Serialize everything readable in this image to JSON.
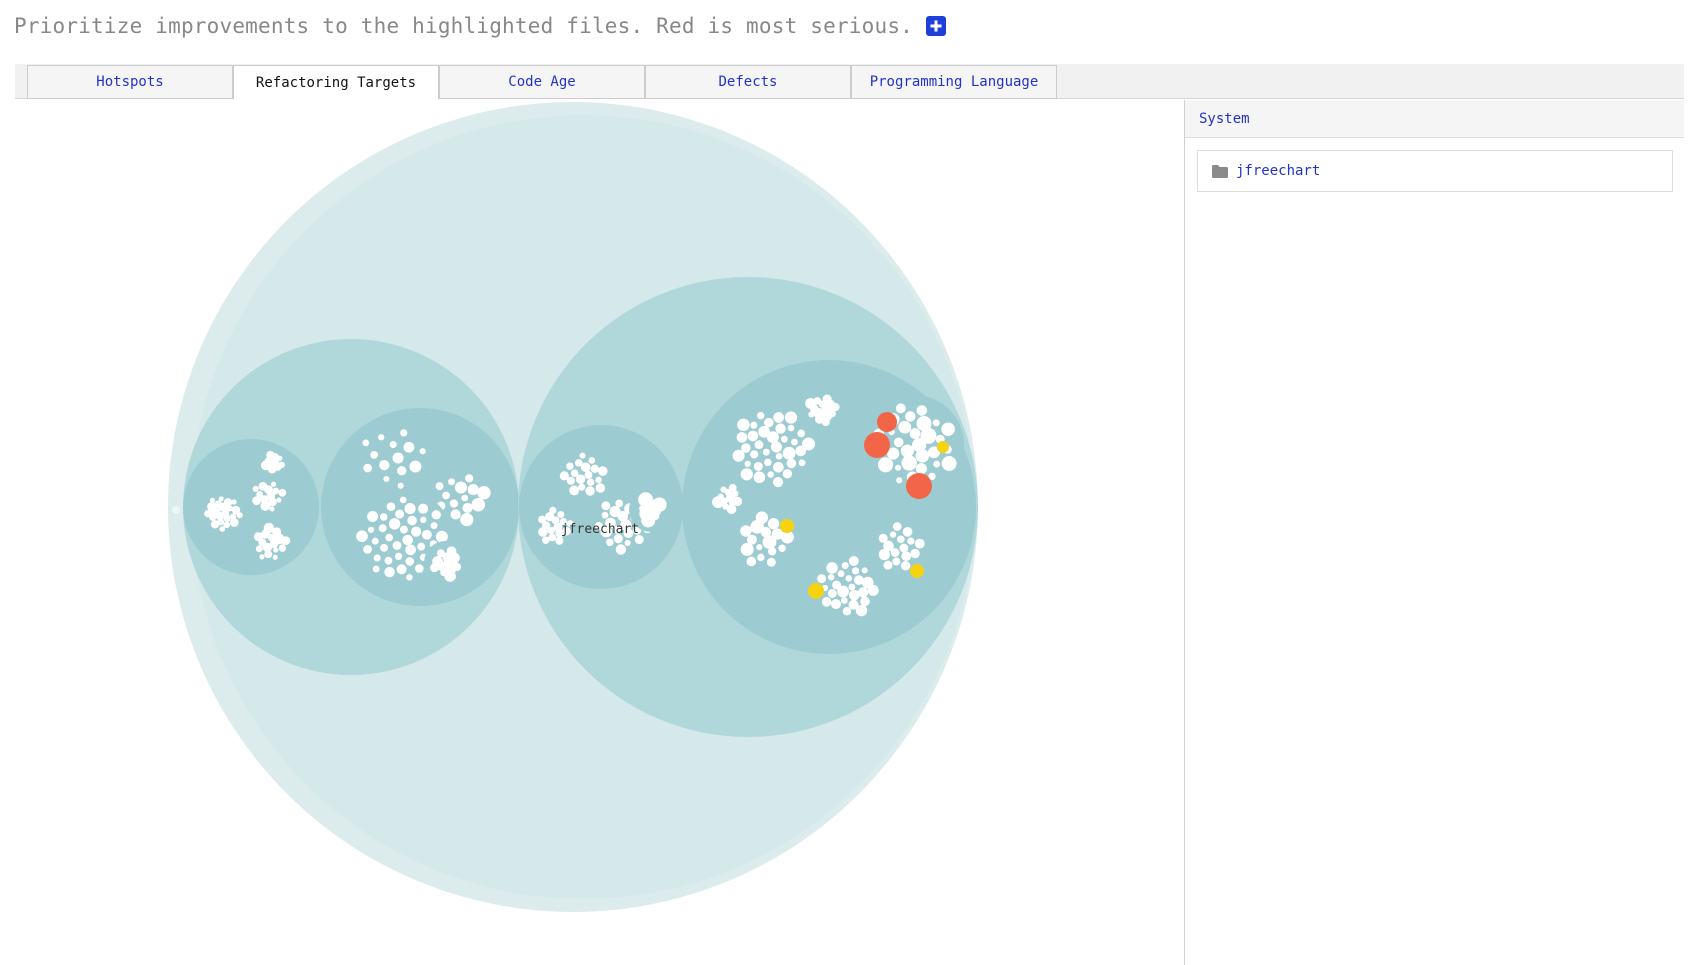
{
  "header": {
    "intro": "Prioritize improvements to the highlighted files. Red is most serious.",
    "expand_icon": "plus-square-icon",
    "accent": "#1f3fd9"
  },
  "tabs": [
    {
      "label": "Hotspots",
      "active": false
    },
    {
      "label": "Refactoring Targets",
      "active": true
    },
    {
      "label": "Code Age",
      "active": false
    },
    {
      "label": "Defects",
      "active": false
    },
    {
      "label": "Programming Language",
      "active": false
    }
  ],
  "visualization": {
    "root_label": "jfreechart",
    "colors": {
      "outer": "#dcecec",
      "level1": "#b0d8db",
      "level2": "#9ccbd1",
      "file": "#ffffff",
      "severe": "#f26549",
      "warning": "#f5d311"
    },
    "severe_count": 3,
    "warning_count": 5
  },
  "side_panel": {
    "header": "System",
    "items": [
      {
        "label": "jfreechart",
        "icon": "folder-icon"
      }
    ]
  }
}
